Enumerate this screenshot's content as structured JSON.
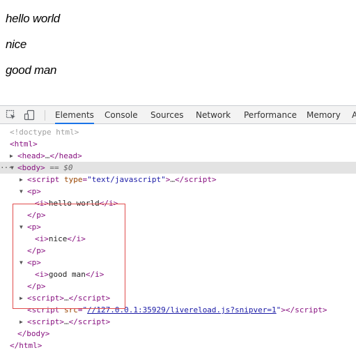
{
  "page": {
    "paragraphs": [
      "hello world",
      "nice",
      "good man"
    ]
  },
  "devtools": {
    "tabs": [
      "Elements",
      "Console",
      "Sources",
      "Network",
      "Performance",
      "Memory",
      "A"
    ],
    "active_tab": "Elements",
    "icons": [
      "inspect-element-icon",
      "device-toolbar-icon"
    ],
    "tree": {
      "doctype": "<!doctype html>",
      "html_open": "html",
      "head": "head",
      "body": "body",
      "selected_marker": "== $0",
      "script_attr_type": "type",
      "script_attr_type_value": "\"text/javascript\"",
      "p_tag": "p",
      "i_tag": "i",
      "p1_text": "hello world",
      "p2_text": "nice",
      "p3_text": "good man",
      "script_tag": "script",
      "src_attr": "src",
      "src_value": "//127.0.0.1:35929/livereload.js?snipver=1",
      "ellipsis": "…"
    },
    "colors": {
      "tag": "#881280",
      "attr_name": "#994500",
      "attr_value": "#1a1aa6",
      "highlight": "#e04b4b",
      "active_tab": "#1a73e8"
    }
  }
}
